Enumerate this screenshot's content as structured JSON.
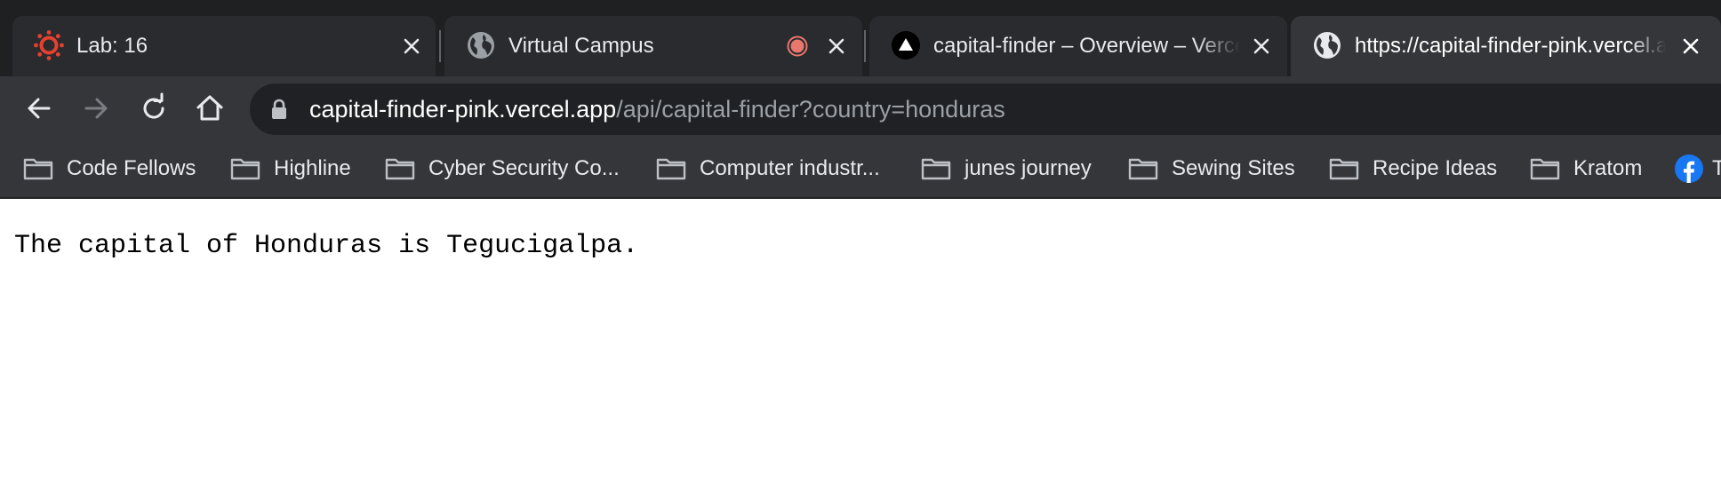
{
  "browser": {
    "tabs": [
      {
        "title": "Lab: 16",
        "icon": "canvas-logo-icon",
        "active": false
      },
      {
        "title": "Virtual Campus",
        "icon": "globe-icon",
        "recording": true,
        "active": false
      },
      {
        "title": "capital-finder – Overview – Vercel",
        "icon": "vercel-logo-icon",
        "active": false
      },
      {
        "title": "https://capital-finder-pink.vercel.app/api/capital-finder?country=honduras",
        "icon": "globe-icon",
        "active": true
      }
    ],
    "address_bar": {
      "host": "capital-finder-pink.vercel.app",
      "path": "/api/capital-finder?country=honduras"
    },
    "bookmarks": [
      {
        "label": "Code Fellows",
        "icon": "folder-icon"
      },
      {
        "label": "Highline",
        "icon": "folder-icon"
      },
      {
        "label": "Cyber Security Co...",
        "icon": "folder-icon"
      },
      {
        "label": "Computer industr...",
        "icon": "folder-icon"
      },
      {
        "label": "junes journey",
        "icon": "folder-icon"
      },
      {
        "label": "Sewing Sites",
        "icon": "folder-icon"
      },
      {
        "label": "Recipe Ideas",
        "icon": "folder-icon"
      },
      {
        "label": "Kratom",
        "icon": "folder-icon"
      },
      {
        "label": "T",
        "icon": "facebook-icon"
      }
    ]
  },
  "page": {
    "text": "The capital of Honduras is Tegucigalpa."
  },
  "colors": {
    "tabstrip_bg": "#1f2022",
    "toolbar_bg": "#35363a",
    "omnibox_bg": "#202124",
    "url_path": "#9aa0a6",
    "canvas_red": "#e4412f",
    "recording_dot": "#e8776d",
    "facebook_blue": "#1877f2"
  }
}
